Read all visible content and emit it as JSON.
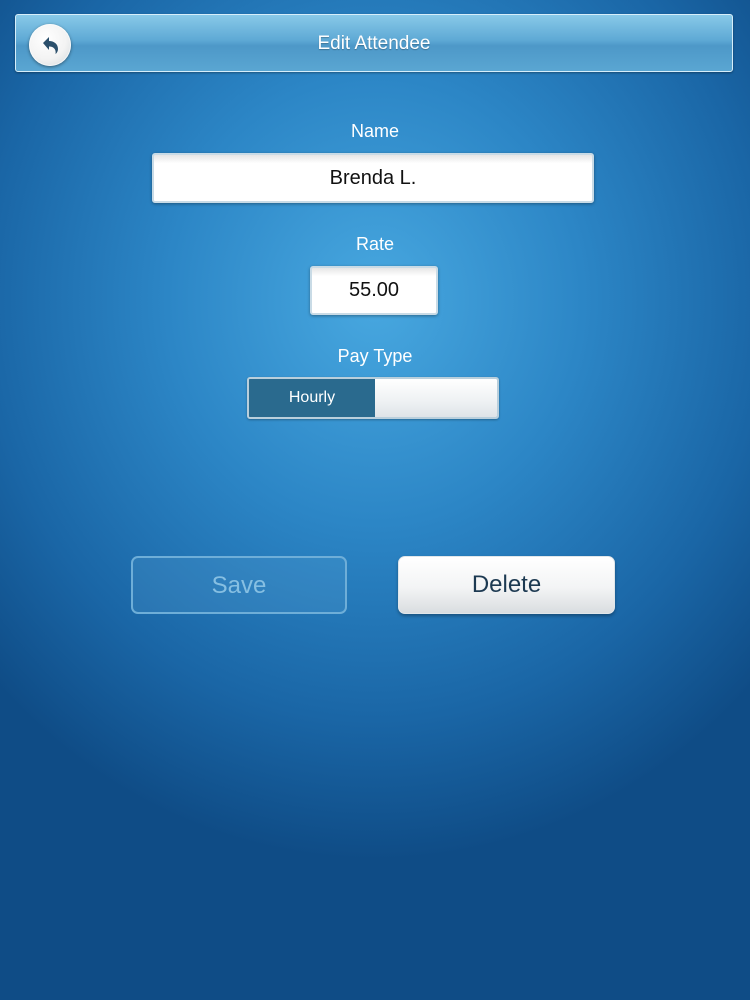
{
  "header": {
    "title": "Edit Attendee",
    "back_icon": "back-arrow-icon"
  },
  "form": {
    "name_label": "Name",
    "name_value": "Brenda L.",
    "rate_label": "Rate",
    "rate_value": "55.00",
    "pay_type_label": "Pay Type",
    "pay_type_selected": "Hourly"
  },
  "actions": {
    "save_label": "Save",
    "delete_label": "Delete"
  },
  "colors": {
    "background_accent": "#2c86c6",
    "toggle_selected": "#2a6a8e",
    "delete_text": "#1d3a52"
  }
}
